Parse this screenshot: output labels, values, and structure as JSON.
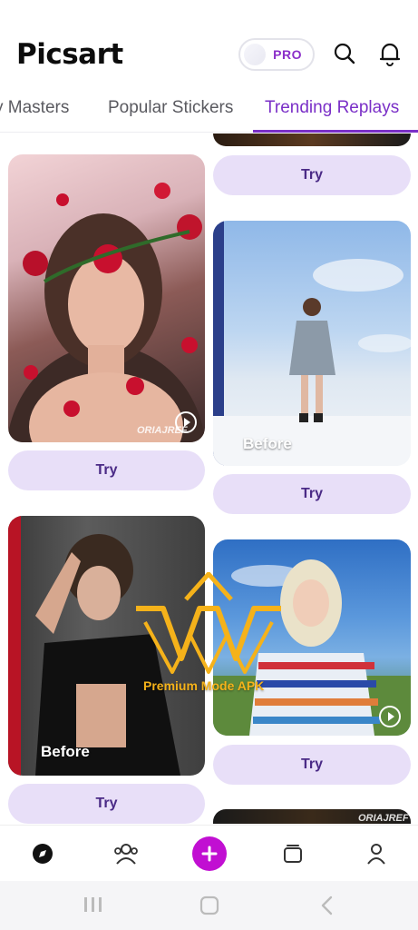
{
  "app": {
    "name": "Picsart",
    "pro_label": "PRO"
  },
  "tabs": [
    {
      "label": "y Masters"
    },
    {
      "label": "Popular Stickers"
    },
    {
      "label": "Trending Replays"
    }
  ],
  "feed": {
    "try_label": "Try",
    "before_label": "Before",
    "watermark": "ORIAJREF"
  },
  "promo": {
    "text": "Premium Mode APK"
  },
  "colors": {
    "accent": "#7a2fc7",
    "try_bg": "#e8dff8",
    "create": "#c10fd2",
    "pro_text": "#8b2fc9"
  },
  "icons": {
    "search": "search-icon",
    "bell": "bell-icon",
    "explore": "compass-icon",
    "community": "people-icon",
    "create": "plus-icon",
    "projects": "folder-icon",
    "profile": "person-icon"
  }
}
